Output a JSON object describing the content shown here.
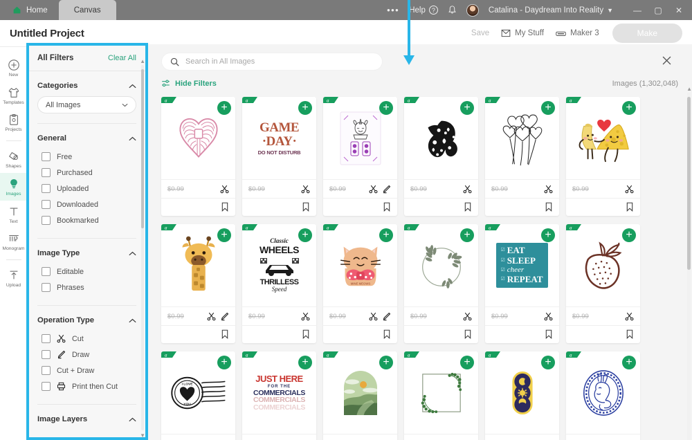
{
  "titlebar": {
    "tabs": [
      {
        "label": "Home",
        "icon": "home-icon",
        "active": false
      },
      {
        "label": "Canvas",
        "icon": "",
        "active": true
      }
    ],
    "overflow_dots": "•••",
    "help_label": "Help",
    "help_icon": "question-circle-icon",
    "bell_icon": "notification-bell-icon",
    "avatar_icon": "user-avatar",
    "account_name": "Catalina - Daydream Into Reality",
    "account_chevron": "chevron-down-icon",
    "window_minimize": "—",
    "window_maximize": "▢",
    "window_close": "✕"
  },
  "projectbar": {
    "title": "Untitled Project",
    "save_label": "Save",
    "my_stuff_label": "My Stuff",
    "my_stuff_icon": "inbox-icon",
    "machine_label": "Maker 3",
    "machine_icon": "machine-icon",
    "make_label": "Make"
  },
  "rail": {
    "items": [
      {
        "label": "New",
        "icon": "plus-circle-icon",
        "selected": false
      },
      {
        "label": "Templates",
        "icon": "tshirt-icon",
        "selected": false
      },
      {
        "label": "Projects",
        "icon": "clipboard-icon",
        "selected": false
      },
      {
        "label": "Shapes",
        "icon": "shapes-icon",
        "selected": false
      },
      {
        "label": "Images",
        "icon": "lightbulb-icon",
        "selected": true
      },
      {
        "label": "Text",
        "icon": "text-t-icon",
        "selected": false
      },
      {
        "label": "Monogram",
        "icon": "monogram-icon",
        "selected": false
      },
      {
        "label": "Upload",
        "icon": "upload-arrow-icon",
        "selected": false
      }
    ]
  },
  "filters": {
    "header_title": "All Filters",
    "clear_all_label": "Clear All",
    "sections": [
      {
        "title": "Categories",
        "collapse_icon": "chevron-up-icon"
      },
      {
        "title": "General",
        "collapse_icon": "chevron-up-icon"
      },
      {
        "title": "Image Type",
        "collapse_icon": "chevron-up-icon"
      },
      {
        "title": "Operation Type",
        "collapse_icon": "chevron-up-icon"
      },
      {
        "title": "Image Layers",
        "collapse_icon": "chevron-up-icon"
      }
    ],
    "category_select_value": "All Images",
    "category_select_chevron": "chevron-down-icon",
    "general_options": [
      {
        "label": "Free",
        "checked": false
      },
      {
        "label": "Purchased",
        "checked": false
      },
      {
        "label": "Uploaded",
        "checked": false
      },
      {
        "label": "Downloaded",
        "checked": false
      },
      {
        "label": "Bookmarked",
        "checked": false
      }
    ],
    "image_type_options": [
      {
        "label": "Editable",
        "checked": false
      },
      {
        "label": "Phrases",
        "checked": false
      }
    ],
    "operation_type_options": [
      {
        "label": "Cut",
        "icon": "scissors-icon",
        "checked": false
      },
      {
        "label": "Draw",
        "icon": "pen-icon",
        "checked": false
      },
      {
        "label": "Cut + Draw",
        "icon": "",
        "checked": false
      },
      {
        "label": "Print then Cut",
        "icon": "printer-icon",
        "checked": false
      }
    ]
  },
  "results": {
    "search_placeholder": "Search in All Images",
    "search_icon": "search-icon",
    "close_icon": "close-icon",
    "hide_filters_label": "Hide Filters",
    "hide_filters_icon": "sliders-icon",
    "image_count_label": "Images (1,302,048)",
    "card_badge_icon": "access-ribbon-icon",
    "card_add_icon": "plus-icon",
    "card_bookmark_icon": "bookmark-icon",
    "cards": [
      {
        "art": "bow-heart",
        "price": "$0.99",
        "ops": [
          "scissors-icon"
        ]
      },
      {
        "art": "game-day",
        "price": "$0.99",
        "ops": [
          "scissors-icon"
        ]
      },
      {
        "art": "unicorn-card",
        "price": "$0.99",
        "ops": [
          "scissors-icon",
          "pen-icon"
        ]
      },
      {
        "art": "black-dragon",
        "price": "$0.99",
        "ops": [
          "scissors-icon"
        ]
      },
      {
        "art": "heart-balloons",
        "price": "$0.99",
        "ops": [
          "scissors-icon"
        ]
      },
      {
        "art": "banana-cheese",
        "price": "$0.99",
        "ops": [
          "scissors-icon"
        ]
      },
      {
        "art": "giraffe",
        "price": "$0.99",
        "ops": [
          "scissors-icon",
          "pen-icon"
        ]
      },
      {
        "art": "classic-wheels",
        "price": "$0.99",
        "ops": [
          "scissors-icon"
        ]
      },
      {
        "art": "bow-cat",
        "price": "$0.99",
        "ops": [
          "scissors-icon",
          "pen-icon"
        ]
      },
      {
        "art": "laurel-wreath",
        "price": "$0.99",
        "ops": [
          "scissors-icon"
        ]
      },
      {
        "art": "eat-sleep-cheer",
        "price": "$0.99",
        "ops": [
          "scissors-icon"
        ]
      },
      {
        "art": "strawberry",
        "price": "$0.99",
        "ops": [
          "scissors-icon"
        ]
      },
      {
        "art": "love-stamp",
        "price": "",
        "ops": []
      },
      {
        "art": "commercials",
        "price": "",
        "ops": []
      },
      {
        "art": "landscape-arch",
        "price": "",
        "ops": []
      },
      {
        "art": "ivy-frame",
        "price": "",
        "ops": []
      },
      {
        "art": "celestial-badge",
        "price": "",
        "ops": []
      },
      {
        "art": "bunny-cameo",
        "price": "",
        "ops": []
      }
    ],
    "card_art_text": {
      "game_day_l1": "GAME",
      "game_day_l2": "·DAY·",
      "game_day_l3": "DO NOT DISTURB",
      "wheels_l1": "Classic",
      "wheels_l2": "WHEELS",
      "wheels_l3": "THRILLESS",
      "wheels_l4": "Speed",
      "cheer_l1": "EAT",
      "cheer_l2": "SLEEP",
      "cheer_l3": "cheer",
      "cheer_l4": "REPEAT",
      "stamp_top": "I LOVE",
      "stamp_bottom": "YOU",
      "comm_l1": "JUST HERE",
      "comm_l2": "FOR THE",
      "comm_l3": "COMMERCIALS"
    }
  },
  "annotations": {
    "highlight_color": "#29b6e8",
    "arrow_icon": "down-arrow-annotation",
    "box_target": "filters-panel"
  },
  "colors": {
    "brand_green": "#179e5e",
    "link_green": "#2aa37d",
    "titlebar_gray": "#7a7a7a",
    "results_bg": "#f4f4f4",
    "filter_bg": "#f7f7f7"
  }
}
